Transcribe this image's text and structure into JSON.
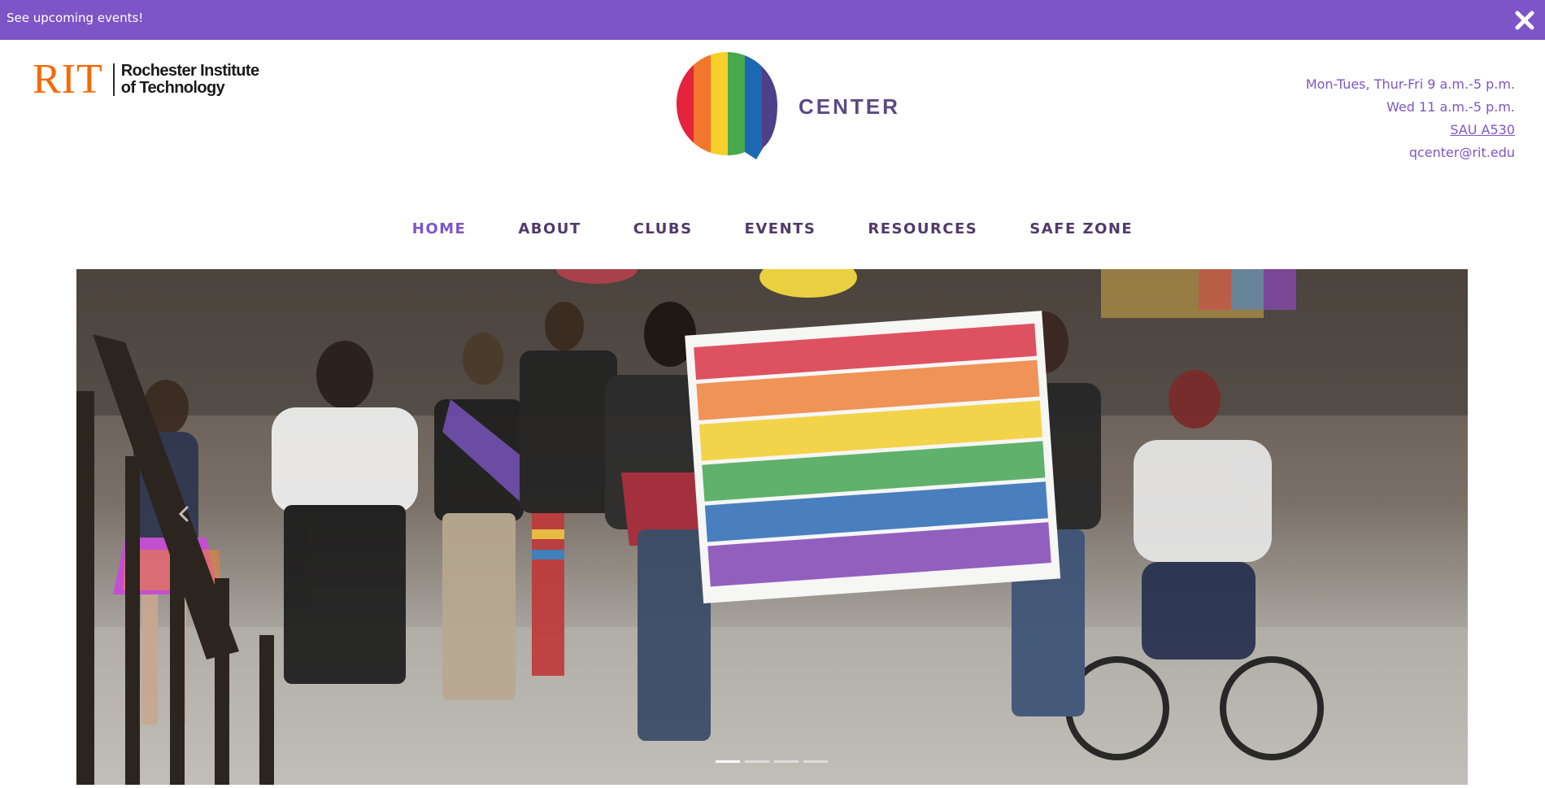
{
  "announcement": {
    "text": "See upcoming events!",
    "close_icon": "close-icon"
  },
  "header": {
    "rit_logo": {
      "mark": "RIT",
      "name_line1": "Rochester Institute",
      "name_line2": "of Technology",
      "color": "#f76902"
    },
    "qcenter_logo": {
      "letter": "Q",
      "word": "CENTER"
    },
    "hours": {
      "line1": "Mon-Tues, Thur-Fri 9 a.m.-5 p.m.",
      "line2": "Wed 11 a.m.-5 p.m.",
      "location": "SAU A530",
      "email": "qcenter@rit.edu"
    }
  },
  "nav": {
    "items": [
      {
        "label": "HOME",
        "active": true
      },
      {
        "label": "ABOUT",
        "active": false
      },
      {
        "label": "CLUBS",
        "active": false
      },
      {
        "label": "EVENTS",
        "active": false
      },
      {
        "label": "RESOURCES",
        "active": false
      },
      {
        "label": "SAFE ZONE",
        "active": false
      }
    ]
  },
  "hero": {
    "prev_icon": "chevron-left-icon",
    "slide_count": 4,
    "active_slide": 1
  },
  "colors": {
    "brand_purple": "#7d55c7",
    "nav_text": "#51396b",
    "rit_orange": "#f76902"
  }
}
